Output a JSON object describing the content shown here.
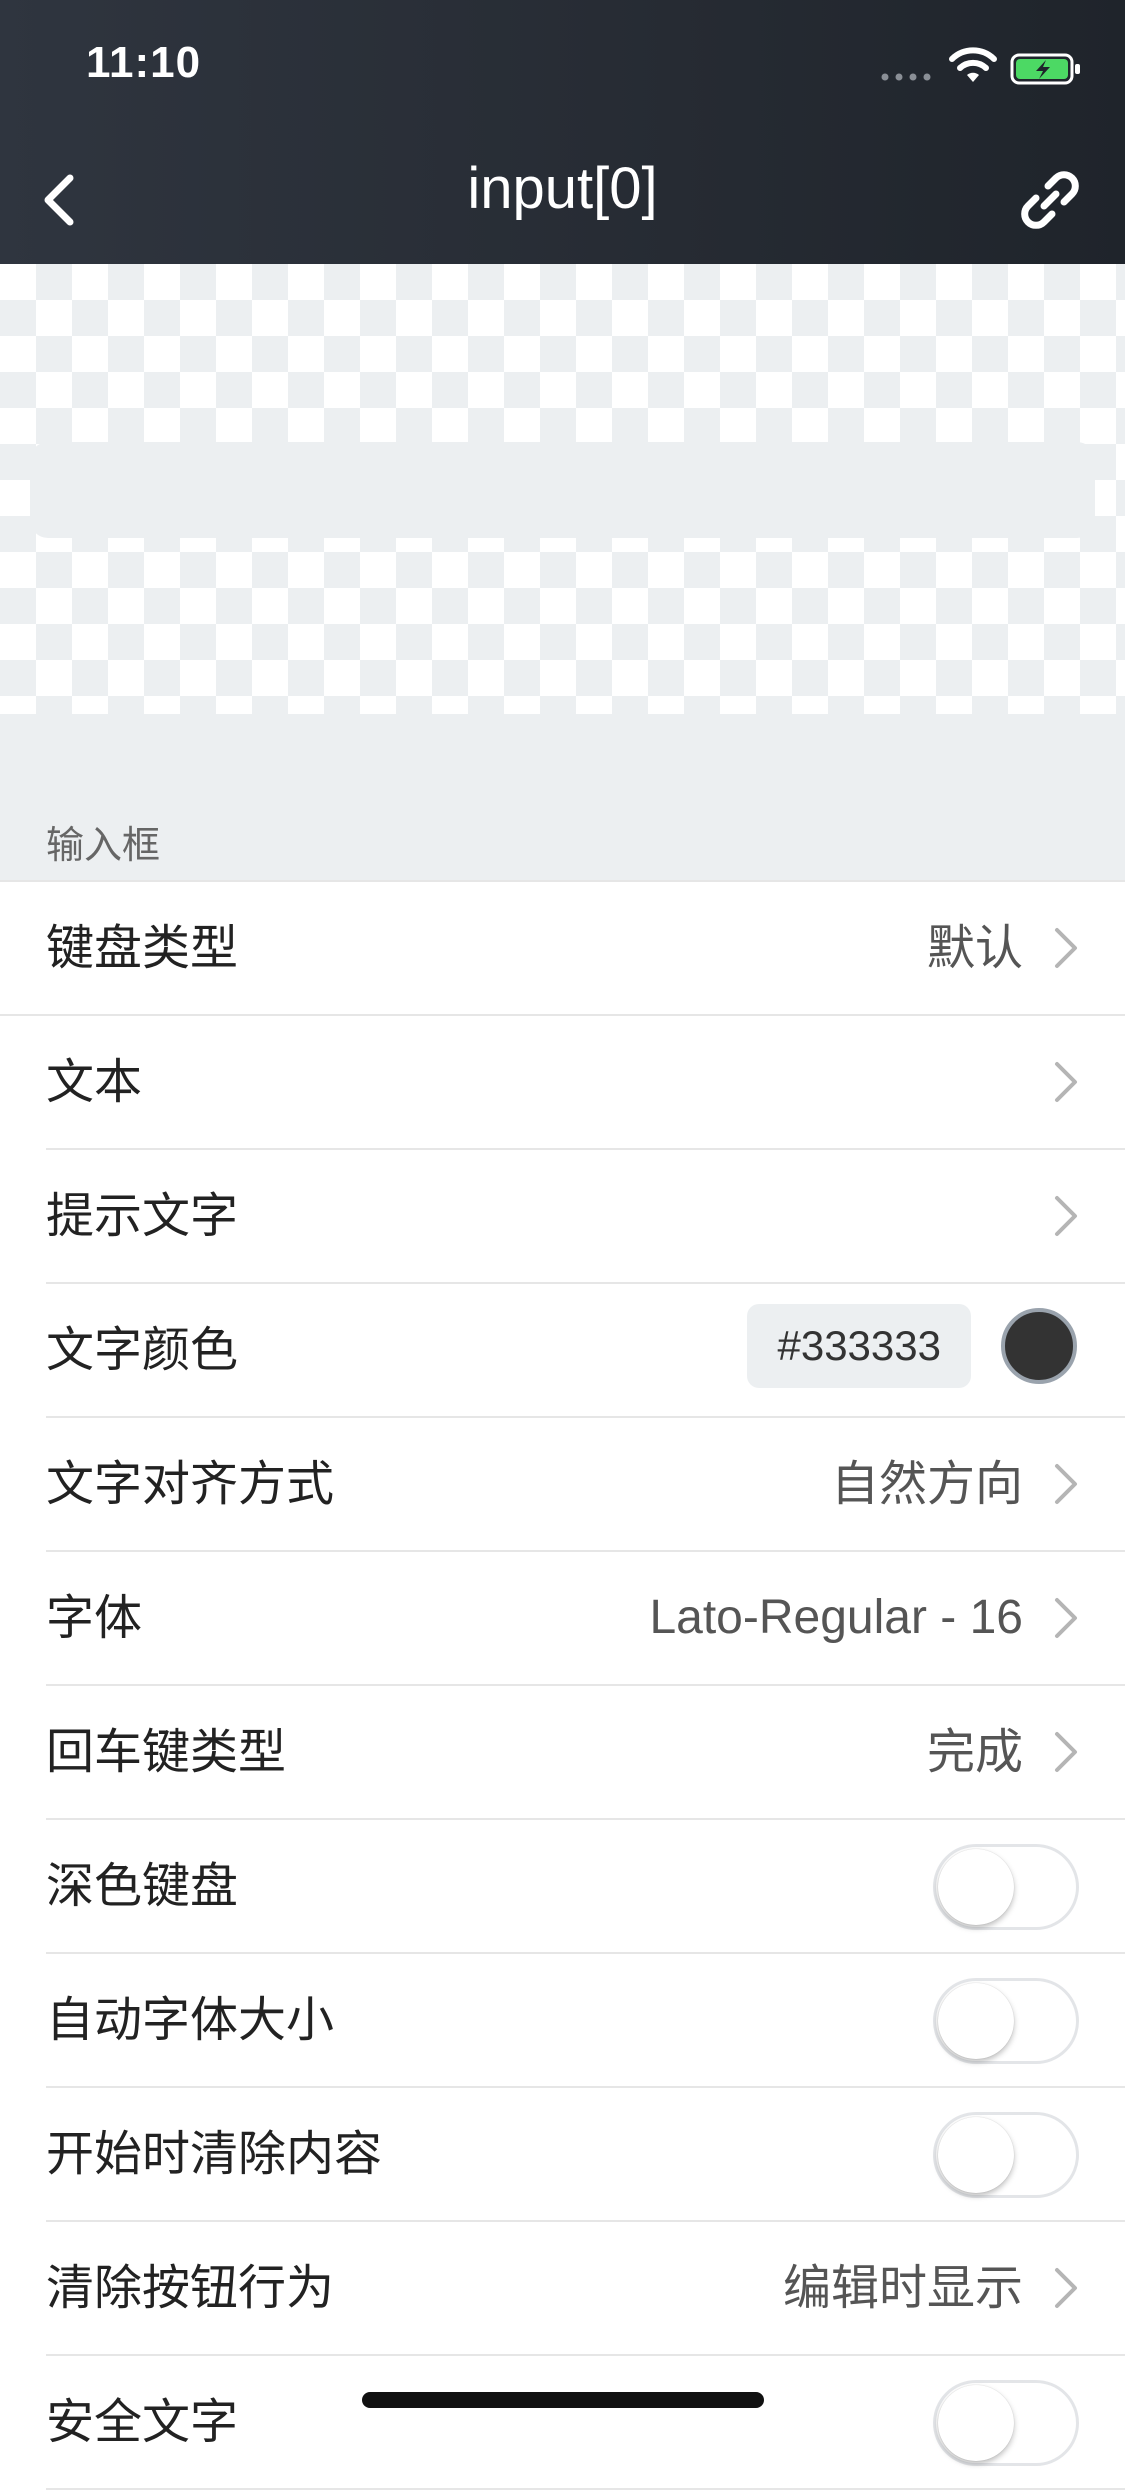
{
  "status_bar": {
    "time": "11:10",
    "signal_icon": "cellular-signal-icon",
    "wifi_icon": "wifi-icon",
    "battery_icon": "battery-charging-icon",
    "battery_color": "#4cd964"
  },
  "nav": {
    "title": "input[0]",
    "back_icon": "chevron-left-icon",
    "link_icon": "link-icon"
  },
  "preview": {
    "input_placeholder": ""
  },
  "section": {
    "title": "输入框"
  },
  "rows": [
    {
      "label": "键盘类型",
      "value": "默认",
      "type": "disclosure"
    },
    {
      "label": "文本",
      "value": "",
      "type": "disclosure"
    },
    {
      "label": "提示文字",
      "value": "",
      "type": "disclosure"
    },
    {
      "label": "文字颜色",
      "value": "#333333",
      "type": "color",
      "swatch_color": "#333333"
    },
    {
      "label": "文字对齐方式",
      "value": "自然方向",
      "type": "disclosure"
    },
    {
      "label": "字体",
      "value": "Lato-Regular - 16",
      "type": "disclosure"
    },
    {
      "label": "回车键类型",
      "value": "完成",
      "type": "disclosure"
    },
    {
      "label": "深色键盘",
      "type": "toggle",
      "on": false
    },
    {
      "label": "自动字体大小",
      "type": "toggle",
      "on": false
    },
    {
      "label": "开始时清除内容",
      "type": "toggle",
      "on": false
    },
    {
      "label": "清除按钮行为",
      "value": "编辑时显示",
      "type": "disclosure"
    },
    {
      "label": "安全文字",
      "type": "toggle",
      "on": false
    }
  ],
  "colors": {
    "header_bg": "#2a2f37",
    "section_bg": "#eceff1",
    "text_primary": "#222222",
    "text_secondary": "#555555"
  }
}
